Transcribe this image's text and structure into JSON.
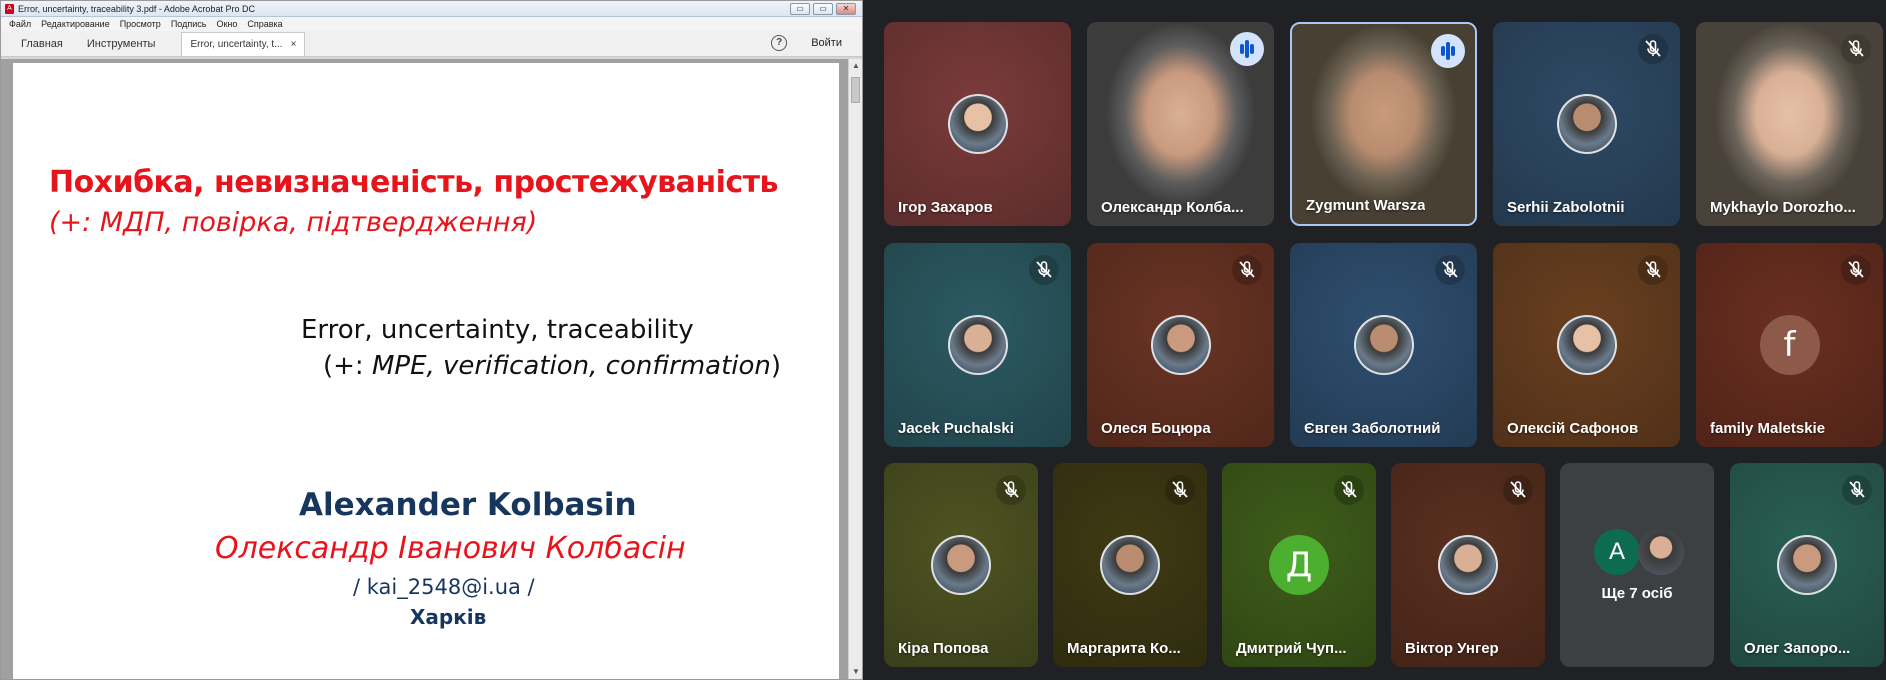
{
  "acrobat": {
    "window_title": "Error, uncertainty, traceability 3.pdf - Adobe Acrobat Pro DC",
    "menu": [
      "Файл",
      "Редактирование",
      "Просмотр",
      "Подпись",
      "Окно",
      "Справка"
    ],
    "tabs": {
      "home": "Главная",
      "tools": "Инструменты",
      "doc": "Error, uncertainty, t..."
    },
    "doc_tab_close": "×",
    "help_glyph": "?",
    "signin_label": "Войти",
    "window_controls": {
      "minimize": "▭",
      "maximize": "▭",
      "close": "✕"
    },
    "slide": {
      "title_ua": "Похибка, невизначеність, простежуваність",
      "subtitle_ua": "(+: МДП, повірка, підтвердження)",
      "title_en": "Error, uncertainty, traceability",
      "subtitle_en_prefix": "(+: ",
      "subtitle_en_italic": "MPE, verification, confirmation",
      "subtitle_en_suffix": ")",
      "author_en": "Alexander Kolbasin",
      "author_ua": "Олександр Іванович Колбасін",
      "email": "/ kai_2548@i.ua /",
      "city": "Харків"
    }
  },
  "meet": {
    "participants": [
      {
        "name": "Ігор Захаров",
        "state": "none",
        "bg": "#7b3b3b"
      },
      {
        "name": "Олександр Колба...",
        "state": "speaking",
        "bg": "#4b4b4b"
      },
      {
        "name": "Zygmunt Warsza",
        "state": "speaking",
        "bg": "#5a5040",
        "active": true
      },
      {
        "name": "Serhii Zabolotnii",
        "state": "muted",
        "bg": "#2f4a66"
      },
      {
        "name": "Mykhaylo Dorozho...",
        "state": "muted",
        "bg": "#5b5348"
      },
      {
        "name": "Jacek Puchalski",
        "state": "muted",
        "bg": "#2c5a63"
      },
      {
        "name": "Олеся Боцюра",
        "state": "muted",
        "bg": "#6a3424"
      },
      {
        "name": "Євген Заболотний",
        "state": "muted",
        "bg": "#2f4f70"
      },
      {
        "name": "Олексій Сафонов",
        "state": "muted",
        "bg": "#6a4020"
      },
      {
        "name": "family Maletskie",
        "state": "muted",
        "bg": "#6a2f20",
        "letter": "f",
        "letter_bg": "#8d5a4a"
      },
      {
        "name": "Кіра Попова",
        "state": "muted",
        "bg": "#4f5422"
      },
      {
        "name": "Маргарита Ко...",
        "state": "muted",
        "bg": "#3f3a14"
      },
      {
        "name": "Дмитрий Чуп...",
        "state": "muted",
        "bg": "#3f5d1a",
        "letter": "Д",
        "letter_bg": "#4caf30"
      },
      {
        "name": "Віктор Унгер",
        "state": "muted",
        "bg": "#5a3020"
      },
      {
        "name": "Олег Запоро...",
        "state": "muted",
        "bg": "#2a6055"
      }
    ],
    "more": {
      "label": "Ще 7 осіб",
      "letter": "A"
    }
  },
  "colors": {
    "title_red": "#e8141c",
    "navy": "#17365d",
    "meet_bg": "#202124",
    "speaking_chip": "#d3e3fd",
    "active_border": "#a8c7fa"
  }
}
